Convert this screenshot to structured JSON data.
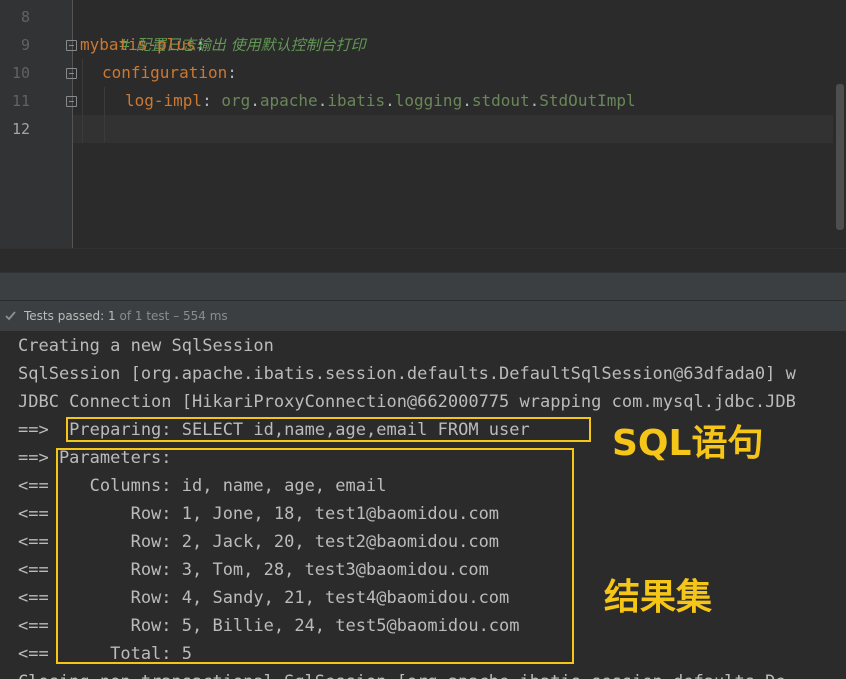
{
  "editor": {
    "line_numbers": [
      "8",
      "9",
      "10",
      "11",
      "12"
    ],
    "comment": "# 配置日志输出 使用默认控制台打印",
    "lines": {
      "mybatis_key": "mybatis-plus",
      "configuration_key": "configuration",
      "log_impl_key": "log-impl",
      "colon": ":",
      "log_impl_value_parts": [
        "org",
        ".",
        "apache",
        ".",
        "ibatis",
        ".",
        "logging",
        ".",
        "stdout",
        ".",
        "StdOutImpl"
      ]
    }
  },
  "status": {
    "prefix": "Tests passed: ",
    "passed": "1",
    "of": " of 1 test",
    "duration": " – 554 ms"
  },
  "console": {
    "lines": [
      "Creating a new SqlSession",
      "SqlSession [org.apache.ibatis.session.defaults.DefaultSqlSession@63dfada0] w",
      "JDBC Connection [HikariProxyConnection@662000775 wrapping com.mysql.jdbc.JDB",
      "==>  Preparing: SELECT id,name,age,email FROM user",
      "==> Parameters: ",
      "<==    Columns: id, name, age, email",
      "<==        Row: 1, Jone, 18, test1@baomidou.com",
      "<==        Row: 2, Jack, 20, test2@baomidou.com",
      "<==        Row: 3, Tom, 28, test3@baomidou.com",
      "<==        Row: 4, Sandy, 21, test4@baomidou.com",
      "<==        Row: 5, Billie, 24, test5@baomidou.com",
      "<==      Total: 5",
      "Closing non transactional SqlSession [org.apache.ibatis.session.defaults.De"
    ]
  },
  "annotations": {
    "sql_label": "SQL语句",
    "result_label": "结果集",
    "highlight_color": "#f5c518"
  },
  "icons": {
    "fold": "fold-marker-icon",
    "status": "check-icon"
  }
}
